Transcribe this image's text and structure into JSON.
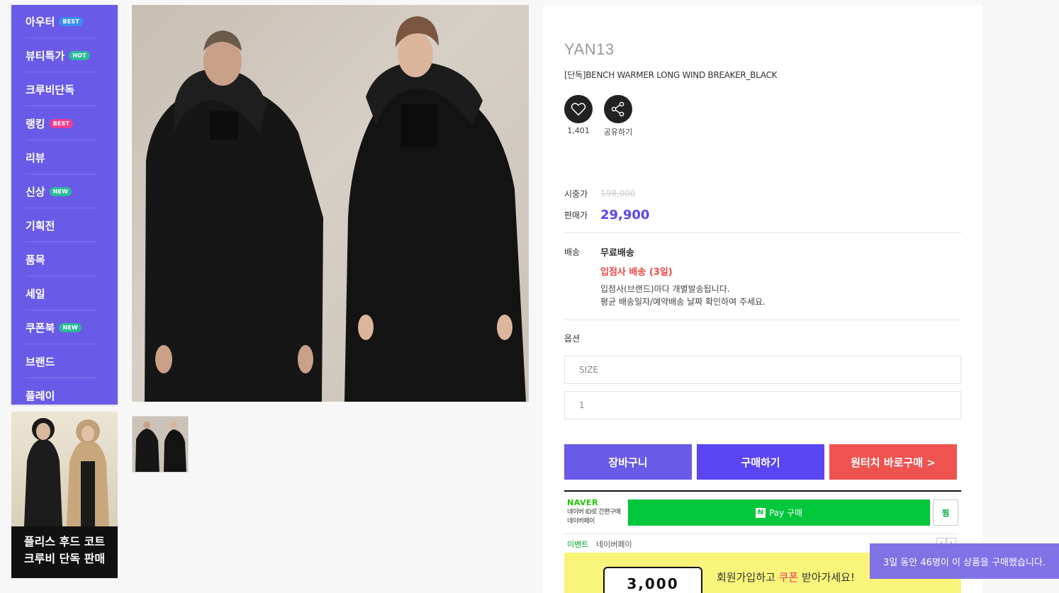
{
  "sidebar": {
    "items": [
      {
        "label": "아우터",
        "badge": "BEST",
        "badge_color": "#3b8ef0"
      },
      {
        "label": "뷰티특가",
        "badge": "HOT",
        "badge_color": "#2ab99a"
      },
      {
        "label": "크루비단독",
        "badge": "",
        "badge_color": ""
      },
      {
        "label": "랭킹",
        "badge": "BEST",
        "badge_color": "#ee3c8f"
      },
      {
        "label": "리뷰",
        "badge": "",
        "badge_color": ""
      },
      {
        "label": "신상",
        "badge": "NEW",
        "badge_color": "#2ab99a"
      },
      {
        "label": "기획전",
        "badge": "",
        "badge_color": ""
      },
      {
        "label": "품목",
        "badge": "",
        "badge_color": ""
      },
      {
        "label": "세일",
        "badge": "",
        "badge_color": ""
      },
      {
        "label": "쿠폰북",
        "badge": "NEW",
        "badge_color": "#2ab99a"
      },
      {
        "label": "브랜드",
        "badge": "",
        "badge_color": ""
      },
      {
        "label": "플레이",
        "badge": "",
        "badge_color": ""
      }
    ],
    "banner": {
      "line1": "플리스 후드 코트",
      "line2": "크루비 단독 판매"
    }
  },
  "product": {
    "brand": "YAN13",
    "name": "[단독]BENCH WARMER LONG WIND BREAKER_BLACK",
    "like_count": "1,401",
    "share_label": "공유하기",
    "list_price_label": "시중가",
    "list_price": "198,000",
    "sale_price_label": "판매가",
    "sale_price": "29,900",
    "shipping_label": "배송",
    "shipping_type": "무료배송",
    "shipping_vendor": "입점사 배송 (3일)",
    "shipping_note1": "입점사(브랜드)마다 개별발송됩니다.",
    "shipping_note2": "평균 배송일자/예약배송 날짜 확인하여 주세요.",
    "option_label": "옵션",
    "size_placeholder": "SIZE",
    "quantity": "1"
  },
  "actions": {
    "cart": "장바구니",
    "buy": "구매하기",
    "one_touch": "원터치 바로구매 >"
  },
  "naver": {
    "logo": "NAVER",
    "line1": "네이버 ID로 간편구매",
    "line2": "네이버페이",
    "pay_label": "Pay 구매",
    "zzim": "찜",
    "event_label": "이벤트",
    "event_sub": "네이버페이"
  },
  "event_banner": {
    "amount": "3,000",
    "text_pre": "회원가입하고 ",
    "text_em": "쿠폰",
    "text_post": " 받아가세요!"
  },
  "toast": {
    "text": "3일 동안 46명이 이 상품을 구매했습니다."
  },
  "colors": {
    "accent": "#5b45f2",
    "sidebar": "#6a5ae8",
    "red": "#ef5350",
    "naver_green": "#00c73c"
  }
}
